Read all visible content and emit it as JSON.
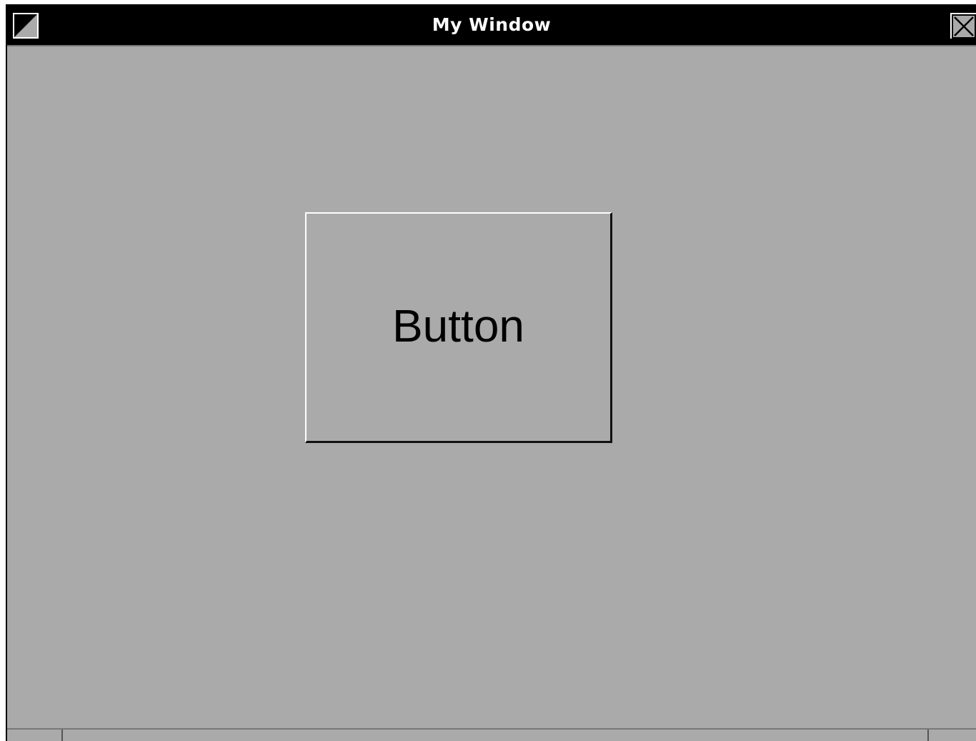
{
  "window": {
    "title": "My Window",
    "menu_icon": "window-menu-icon",
    "close_icon": "close-icon"
  },
  "main": {
    "button_label": "Button"
  },
  "colors": {
    "titlebar_bg": "#000000",
    "title_text": "#ffffff",
    "window_bg": "#aaaaaa"
  }
}
